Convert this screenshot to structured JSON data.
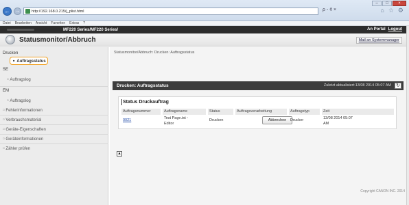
{
  "browser": {
    "address": "http://192.168.0.215/j_plist.html",
    "search_hint": "ρ - ¢ ×",
    "window_controls": {
      "minimize": "–",
      "maximize": "□",
      "close": "×"
    }
  },
  "menubar": [
    "Datei",
    "Bearbeiten",
    "Ansicht",
    "Favoriten",
    "Extras",
    "?"
  ],
  "header": {
    "model": "MF220 Series/MF220 Series/",
    "portal": "An Portal",
    "logout": "Logout"
  },
  "subheader": {
    "title": "Statusmonitor/Abbruch",
    "mail_admin": "Mail an Systemmanager"
  },
  "sidebar": {
    "drucken": "Drucken",
    "auftragsstatus": "Auftragsstatus",
    "se": "SE",
    "auftragslog_1": "Auftragslog",
    "em": "EM",
    "auftragslog_2": "Auftragslog",
    "fehlerinformationen": "Fehlerinformationen",
    "verbrauchsmaterial": "Verbrauchsmaterial",
    "geraete_eigenschaften": "Geräte-Eigenschaften",
    "geraeteinformationen": "Geräteinformationen",
    "zaehler_pruefen": "Zähler prüfen"
  },
  "main": {
    "breadcrumb": "Statusmonitor/Abbruch: Drucken: Auftragsstatus",
    "bar_title": "Drucken: Auftragsstatus",
    "updated": "Zuletzt aktualisiert:13/08 2014 05:07 AM",
    "panel_title": "Status Druckauftrag",
    "columns": [
      "Auftragsnummer",
      "Auftragsname",
      "Status",
      "Auftragsverarbeitung",
      "Auftragstyp",
      "Zeit"
    ],
    "row": {
      "nummer": "0021",
      "name_1": "Test Page.txt -",
      "name_2": "Editor",
      "status": "Drucken",
      "action": "Abbrechen",
      "typ": "Drucker",
      "zeit_1": "13/08 2014 05:07",
      "zeit_2": "AM"
    },
    "copyright": "Copyright CANON INC. 2014"
  }
}
